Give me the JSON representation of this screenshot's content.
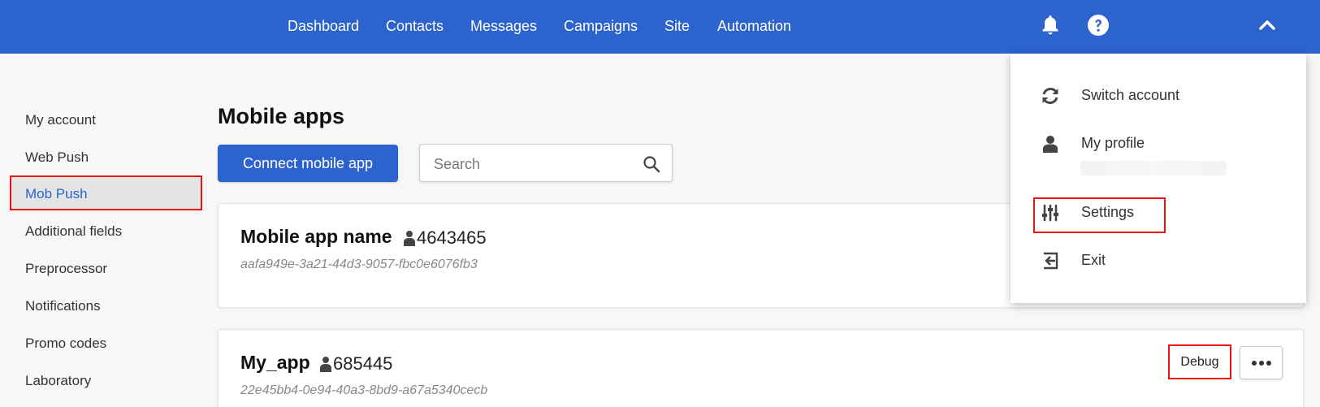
{
  "nav": {
    "items": [
      "Dashboard",
      "Contacts",
      "Messages",
      "Campaigns",
      "Site",
      "Automation"
    ],
    "icons": [
      "bell-icon",
      "help-icon",
      "chevron-up-icon"
    ]
  },
  "sidebar": {
    "items": [
      "My account",
      "Web Push",
      "Mob Push",
      "Additional fields",
      "Preprocessor",
      "Notifications",
      "Promo codes",
      "Laboratory"
    ],
    "active": "Mob Push"
  },
  "main": {
    "title": "Mobile apps",
    "connect_label": "Connect mobile app",
    "search_placeholder": "Search",
    "apps": [
      {
        "name": "Mobile app name",
        "count": "4643465",
        "id": "aafa949e-3a21-44d3-9057-fbc0e6076fb3"
      },
      {
        "name": "My_app",
        "count": "685445",
        "id": "22e45bb4-0e94-40a3-8bd9-a67a5340cecb",
        "debug_label": "Debug"
      }
    ]
  },
  "menu": {
    "items": [
      {
        "label": "Switch account",
        "icon": "sync-icon"
      },
      {
        "label": "My profile",
        "icon": "user-icon"
      },
      {
        "label": "Settings",
        "icon": "sliders-icon"
      },
      {
        "label": "Exit",
        "icon": "exit-icon"
      }
    ]
  },
  "colors": {
    "primary": "#2d63cf",
    "highlight_border": "#ee1111"
  }
}
